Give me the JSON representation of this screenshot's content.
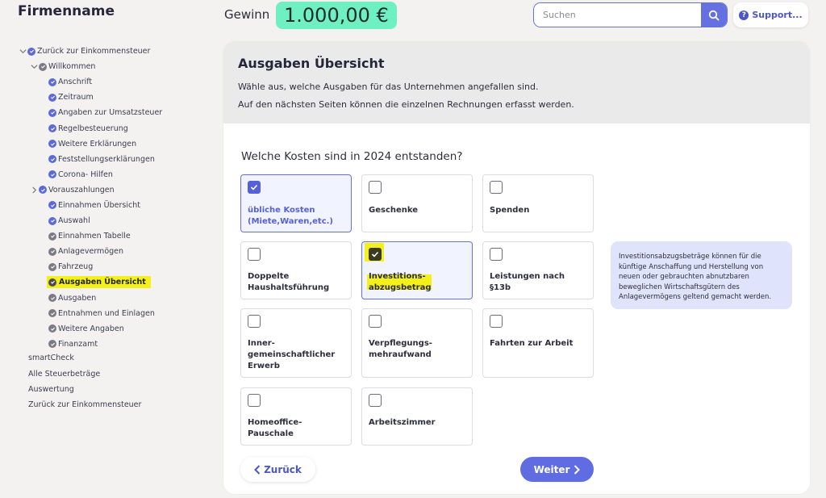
{
  "brand": "Firmenname",
  "header": {
    "gewinn_label": "Gewinn",
    "gewinn_value": "1.000,00 €",
    "search_placeholder": "Suchen",
    "support_label": "Support..."
  },
  "sidebar": {
    "tree": [
      {
        "label": "Zurück zur Einkommensteuer",
        "level": 0,
        "chevron": "down",
        "status": "blue"
      },
      {
        "label": "Willkommen",
        "level": 1,
        "chevron": "down",
        "status": "grey"
      },
      {
        "label": "Anschrift",
        "level": 2,
        "status": "blue"
      },
      {
        "label": "Zeitraum",
        "level": 2,
        "status": "blue"
      },
      {
        "label": "Angaben zur Umsatzsteuer",
        "level": 2,
        "status": "blue"
      },
      {
        "label": "Regelbesteuerung",
        "level": 2,
        "status": "blue"
      },
      {
        "label": "Weitere Erklärungen",
        "level": 2,
        "status": "blue"
      },
      {
        "label": "Feststellungserklärungen",
        "level": 2,
        "status": "blue"
      },
      {
        "label": "Corona- Hilfen",
        "level": 2,
        "status": "blue"
      },
      {
        "label": "Vorauszahlungen",
        "level": 2,
        "chevron": "right",
        "status": "blue"
      },
      {
        "label": "Einnahmen Übersicht",
        "level": 2,
        "status": "blue"
      },
      {
        "label": "Auswahl",
        "level": 2,
        "status": "blue"
      },
      {
        "label": "Einnahmen Tabelle",
        "level": 2,
        "status": "grey"
      },
      {
        "label": "Anlagevermögen",
        "level": 2,
        "status": "grey"
      },
      {
        "label": "Fahrzeug",
        "level": 2,
        "status": "grey"
      },
      {
        "label": "Ausgaben Übersicht",
        "level": 2,
        "status": "dark",
        "active": true
      },
      {
        "label": "Ausgaben",
        "level": 2,
        "status": "grey"
      },
      {
        "label": "Entnahmen und Einlagen",
        "level": 2,
        "status": "grey"
      },
      {
        "label": "Weitere Angaben",
        "level": 2,
        "status": "grey"
      },
      {
        "label": "Finanzamt",
        "level": 2,
        "status": "grey"
      }
    ],
    "links": [
      "smartCheck",
      "Alle Steuerbeträge",
      "Auswertung",
      "Zurück zur Einkommensteuer"
    ]
  },
  "main": {
    "title": "Ausgaben Übersicht",
    "subtitle_1": "Wähle aus, welche Ausgaben für das Unternehmen angefallen sind.",
    "subtitle_2": "Auf den nächsten Seiten können die einzelnen Rechnungen erfasst werden.",
    "question": "Welche Kosten sind in 2024 entstanden?",
    "options": [
      {
        "label": "übliche Kosten (Miete,Waren,etc.)",
        "checked": true
      },
      {
        "label": "Geschenke",
        "checked": false
      },
      {
        "label": "Spenden",
        "checked": false
      },
      {
        "label": "Doppelte Haushaltsführung",
        "checked": false
      },
      {
        "label": "Investitions- abzugsbetrag",
        "checked": true
      },
      {
        "label": "Leistungen nach §13b",
        "checked": false
      },
      {
        "label": "Inner- gemeinschaftlicher Erwerb",
        "checked": false
      },
      {
        "label": "Verpflegungs- mehraufwand",
        "checked": false
      },
      {
        "label": "Fahrten zur Arbeit",
        "checked": false
      },
      {
        "label": "Homeoffice- Pauschale",
        "checked": false
      },
      {
        "label": "Arbeitszimmer",
        "checked": false
      }
    ],
    "info_text": "Investitionsabzugsbeträge können für die künftige Anschaffung und Herstellung von neuen oder gebrauchten abnutzbaren beweglichen Wirtschaftsgütern des Anlagevermögens geltend gemacht werden.",
    "back_label": "Zurück",
    "next_label": "Weiter"
  },
  "colors": {
    "accent": "#6571e0",
    "highlight": "#f4f11a",
    "gewinn_bg": "#6ef0c3"
  }
}
